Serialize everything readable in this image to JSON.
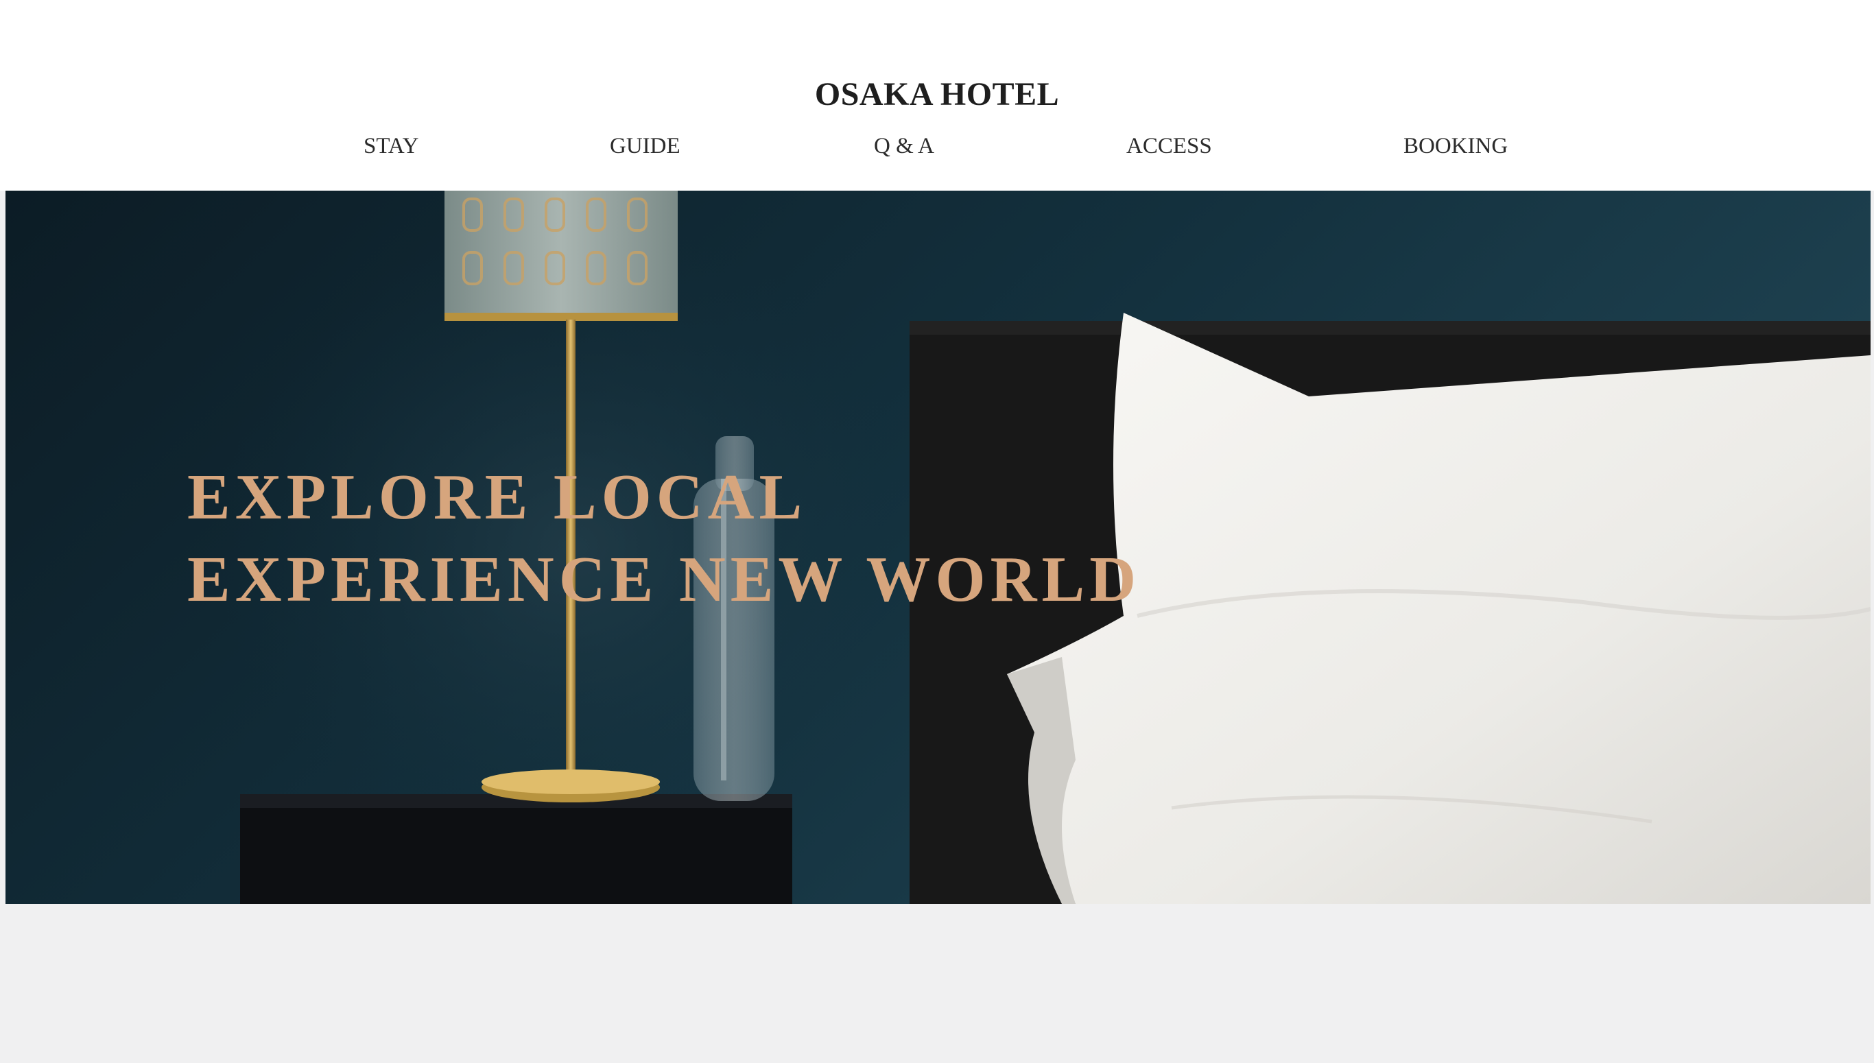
{
  "header": {
    "logo": "OSAKA HOTEL",
    "nav": [
      {
        "label": "STAY"
      },
      {
        "label": "GUIDE"
      },
      {
        "label": "Q & A"
      },
      {
        "label": "ACCESS"
      },
      {
        "label": "BOOKING"
      }
    ]
  },
  "hero": {
    "headline_line1": "EXPLORE LOCAL",
    "headline_line2": "EXPERIENCE NEW WORLD",
    "image": "hotel-bedroom-photo",
    "headline_color": "#d6a57d"
  },
  "colors": {
    "wall": "#12303d",
    "footer_band": "#f0f0f1"
  }
}
